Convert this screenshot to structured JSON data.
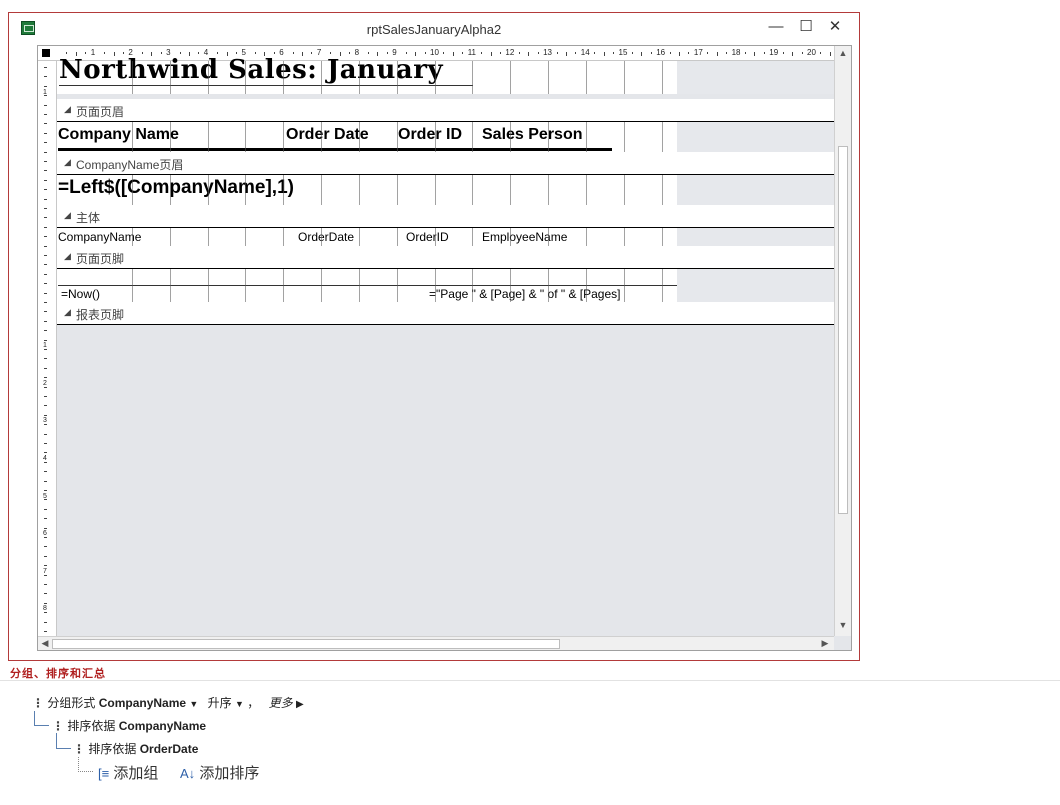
{
  "window": {
    "title": "rptSalesJanuaryAlpha2",
    "controls": {
      "minimize": "—",
      "maximize": "☐",
      "close": "✕"
    }
  },
  "ruler": {
    "h_numbers": [
      "1",
      "2",
      "3",
      "4",
      "5",
      "6",
      "7",
      "8",
      "9",
      "10",
      "11",
      "12",
      "13",
      "14",
      "15",
      "16",
      "17",
      "18",
      "19",
      "20"
    ],
    "v_numbers": [
      "1",
      "1",
      "2",
      "3",
      "4",
      "5",
      "6",
      "7",
      "8"
    ]
  },
  "report": {
    "title_text": "Northwind Sales: January",
    "sections": {
      "page_header": "页面页眉",
      "group_header": "CompanyName页眉",
      "detail": "主体",
      "page_footer": "页面页脚",
      "report_footer": "报表页脚"
    },
    "header_labels": [
      "Company Name",
      "Order Date",
      "Order ID",
      "Sales Person"
    ],
    "group_expression": "=Left$([CompanyName],1)",
    "detail_fields": [
      "CompanyName",
      "OrderDate",
      "OrderID",
      "EmployeeName"
    ],
    "footer_now": "=Now()",
    "footer_pages": "=\"Page \" & [Page] & \" of \" & [Pages]"
  },
  "grouping": {
    "pane_title": "分组、排序和汇总",
    "group_row": {
      "prefix": "分组形式",
      "field": "CompanyName",
      "order": "升序",
      "more": "更多"
    },
    "sort1": {
      "prefix": "排序依据",
      "field": "CompanyName"
    },
    "sort2": {
      "prefix": "排序依据",
      "field": "OrderDate"
    },
    "add_group": "添加组",
    "add_sort": "添加排序"
  }
}
